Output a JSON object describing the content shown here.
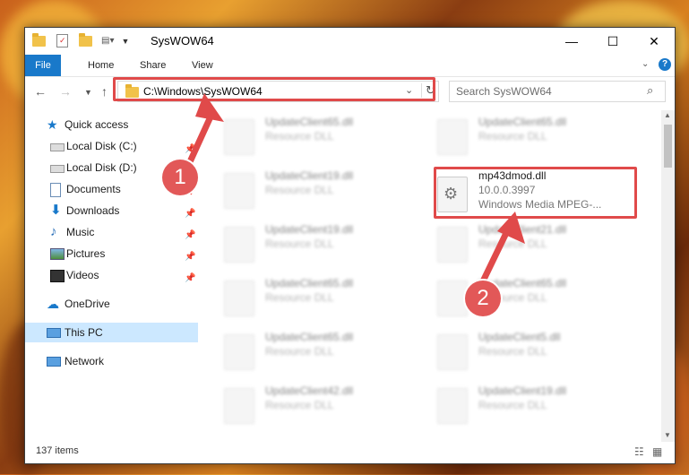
{
  "window": {
    "title": "SysWOW64",
    "controls": {
      "minimize": "—",
      "maximize": "☐",
      "close": "✕"
    }
  },
  "ribbon": {
    "tabs": [
      "File",
      "Home",
      "Share",
      "View"
    ],
    "help": "?"
  },
  "navbar": {
    "address": "C:\\Windows\\SysWOW64",
    "search_placeholder": "Search SysWOW64"
  },
  "sidebar": {
    "items": [
      {
        "label": "Quick access",
        "icon": "star-icon",
        "pinned": false
      },
      {
        "label": "Local Disk (C:)",
        "icon": "drive-icon",
        "pinned": true
      },
      {
        "label": "Local Disk (D:)",
        "icon": "drive-icon",
        "pinned": true
      },
      {
        "label": "Documents",
        "icon": "documents-icon",
        "pinned": true
      },
      {
        "label": "Downloads",
        "icon": "downloads-icon",
        "pinned": true
      },
      {
        "label": "Music",
        "icon": "music-icon",
        "pinned": true
      },
      {
        "label": "Pictures",
        "icon": "pictures-icon",
        "pinned": true
      },
      {
        "label": "Videos",
        "icon": "videos-icon",
        "pinned": true
      },
      {
        "label": "OneDrive",
        "icon": "cloud-icon",
        "pinned": false
      },
      {
        "label": "This PC",
        "icon": "computer-icon",
        "pinned": false
      },
      {
        "label": "Network",
        "icon": "network-icon",
        "pinned": false
      }
    ]
  },
  "files": {
    "left": [
      {
        "name": "UpdateClient65.dll",
        "type": "Resource DLL"
      },
      {
        "name": "UpdateClient19.dll",
        "type": "Resource DLL"
      },
      {
        "name": "UpdateClient19.dll",
        "type": "Resource DLL"
      },
      {
        "name": "UpdateClient65.dll",
        "type": "Resource DLL"
      },
      {
        "name": "UpdateClient65.dll",
        "type": "Resource DLL"
      },
      {
        "name": "UpdateClient42.dll",
        "type": "Resource DLL"
      }
    ],
    "right": [
      {
        "name": "UpdateClient65.dll",
        "type": "Resource DLL"
      },
      {
        "name": "mp43dmod.dll",
        "version": "10.0.0.3997",
        "type": "Windows Media MPEG-..."
      },
      {
        "name": "UpdateClient21.dll",
        "type": "Resource DLL"
      },
      {
        "name": "UpdateClient65.dll",
        "type": "Resource DLL"
      },
      {
        "name": "UpdateClient5.dll",
        "type": "Resource DLL"
      },
      {
        "name": "UpdateClient19.dll",
        "type": "Resource DLL"
      }
    ]
  },
  "status": {
    "items_count": "137 items"
  },
  "annotations": {
    "step1": "1",
    "step2": "2"
  },
  "colors": {
    "accent": "#1979ca",
    "highlight": "#e04a4a",
    "selected": "#cce8ff"
  }
}
